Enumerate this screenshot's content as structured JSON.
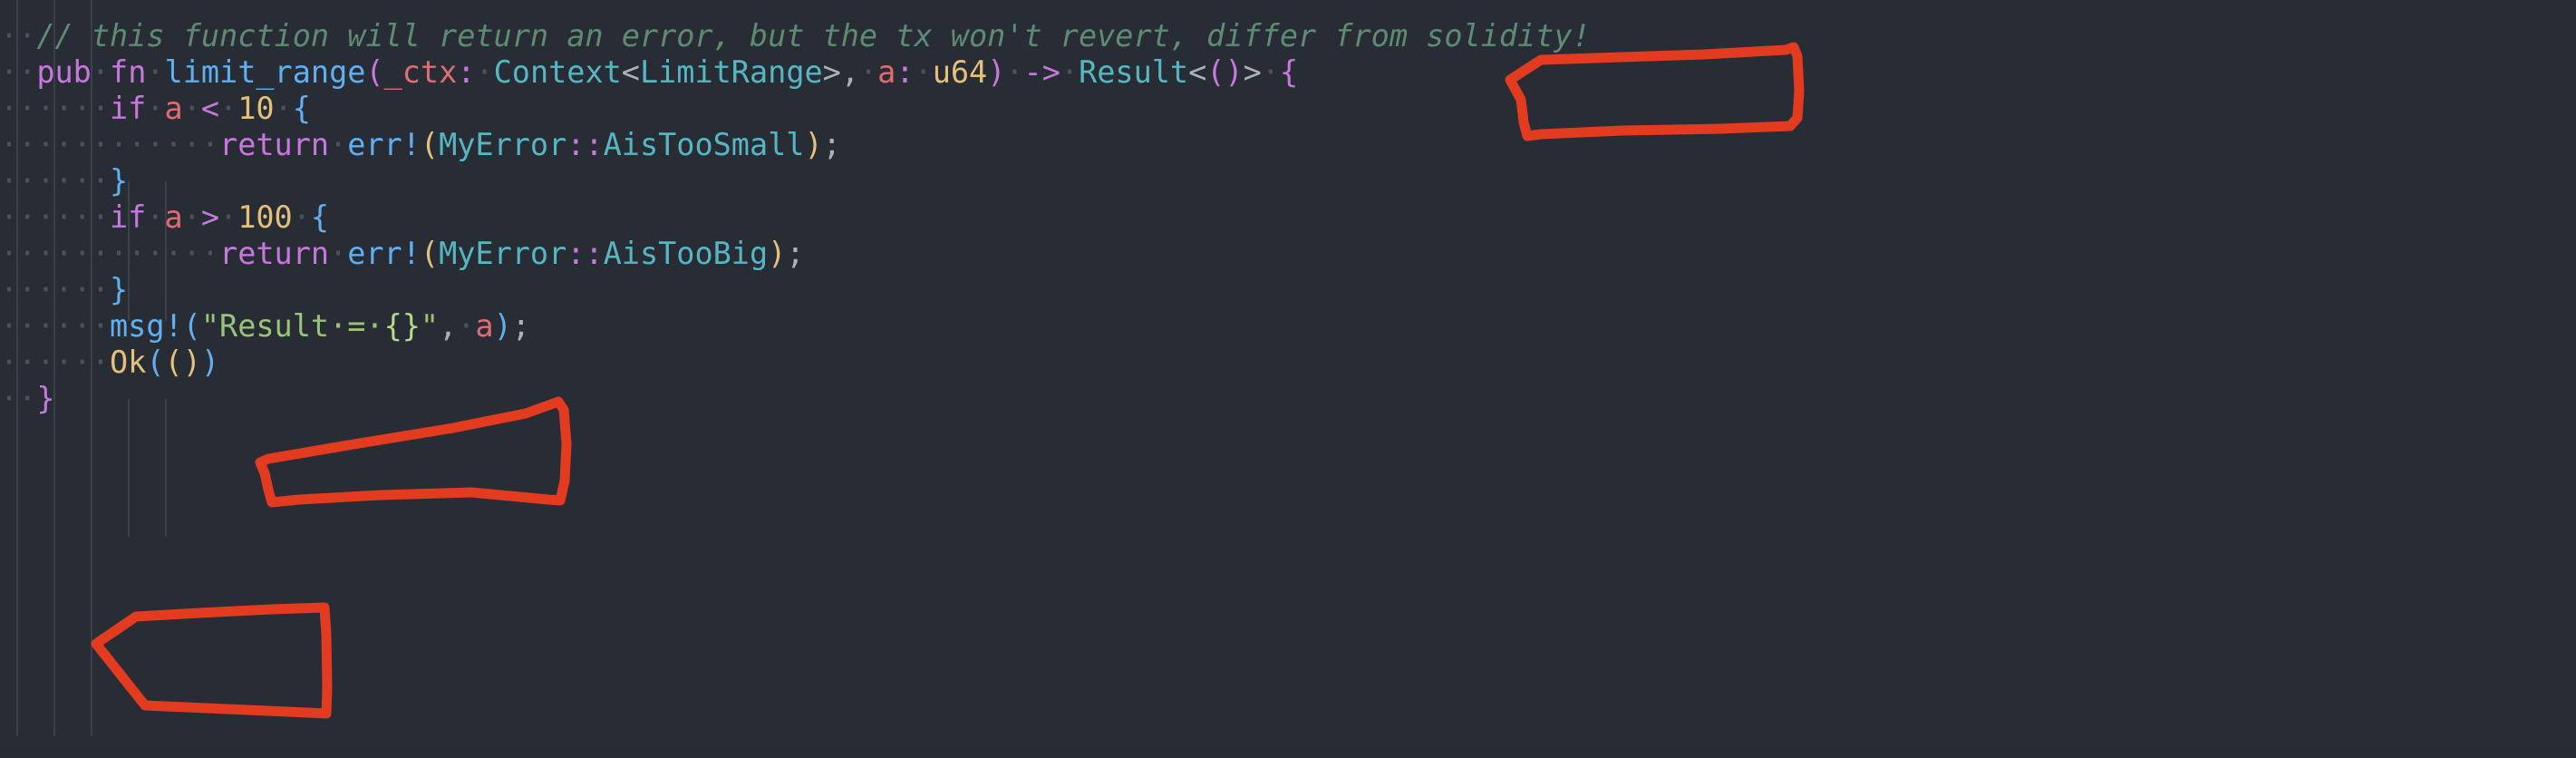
{
  "editor": {
    "background": "#282c34",
    "language": "rust",
    "whitespace_dot": "·",
    "indent_guide_color": "#3b4049",
    "font_size_px": 33.5,
    "line_height_px": 40
  },
  "annotation": {
    "color": "#e23b20",
    "stroke_width": 9,
    "tool": "freehand-marker",
    "shapes": [
      {
        "name": "highlight-box-result-type",
        "target_text": "Result<()>"
      },
      {
        "name": "highlight-box-return-err",
        "target_text": "return err!("
      },
      {
        "name": "highlight-box-ok-unit",
        "target_text": "Ok(())"
      }
    ]
  },
  "code": {
    "lines": [
      {
        "n": 1,
        "indent": 0,
        "tokens": [
          {
            "t": "··",
            "c": "ws"
          },
          {
            "t": "// this function will return an error, but the tx won't revert, differ from solidity!",
            "c": "comment"
          }
        ]
      },
      {
        "n": 2,
        "indent": 0,
        "tokens": [
          {
            "t": "··",
            "c": "ws"
          },
          {
            "t": "pub",
            "c": "keyword"
          },
          {
            "t": "·",
            "c": "ws"
          },
          {
            "t": "fn",
            "c": "keyword"
          },
          {
            "t": "·",
            "c": "ws"
          },
          {
            "t": "limit_range",
            "c": "fn"
          },
          {
            "t": "(",
            "c": "brace-m"
          },
          {
            "t": "_ctx",
            "c": "param"
          },
          {
            "t": ":",
            "c": "op"
          },
          {
            "t": "·",
            "c": "ws"
          },
          {
            "t": "Context",
            "c": "type"
          },
          {
            "t": "<",
            "c": "punct"
          },
          {
            "t": "LimitRange",
            "c": "type"
          },
          {
            "t": ">",
            "c": "punct"
          },
          {
            "t": ",",
            "c": "punct"
          },
          {
            "t": "·",
            "c": "ws"
          },
          {
            "t": "a",
            "c": "param"
          },
          {
            "t": ":",
            "c": "op"
          },
          {
            "t": "·",
            "c": "ws"
          },
          {
            "t": "u64",
            "c": "number"
          },
          {
            "t": ")",
            "c": "brace-m"
          },
          {
            "t": "·",
            "c": "ws"
          },
          {
            "t": "->",
            "c": "op"
          },
          {
            "t": "·",
            "c": "ws"
          },
          {
            "t": "Result",
            "c": "type"
          },
          {
            "t": "<",
            "c": "punct"
          },
          {
            "t": "()",
            "c": "brace-m"
          },
          {
            "t": ">",
            "c": "punct"
          },
          {
            "t": "·",
            "c": "ws"
          },
          {
            "t": "{",
            "c": "brace-m"
          }
        ]
      },
      {
        "n": 3,
        "indent": 1,
        "tokens": [
          {
            "t": "······",
            "c": "ws"
          },
          {
            "t": "if",
            "c": "keyword"
          },
          {
            "t": "·",
            "c": "ws"
          },
          {
            "t": "a",
            "c": "param"
          },
          {
            "t": "·",
            "c": "ws"
          },
          {
            "t": "<",
            "c": "op"
          },
          {
            "t": "·",
            "c": "ws"
          },
          {
            "t": "10",
            "c": "number"
          },
          {
            "t": "·",
            "c": "ws"
          },
          {
            "t": "{",
            "c": "brace-b"
          }
        ]
      },
      {
        "n": 4,
        "indent": 2,
        "tokens": [
          {
            "t": "············",
            "c": "ws"
          },
          {
            "t": "return",
            "c": "keyword"
          },
          {
            "t": "·",
            "c": "ws"
          },
          {
            "t": "err!",
            "c": "macro"
          },
          {
            "t": "(",
            "c": "brace-y"
          },
          {
            "t": "MyError",
            "c": "type"
          },
          {
            "t": "::",
            "c": "op"
          },
          {
            "t": "AisTooSmall",
            "c": "type"
          },
          {
            "t": ")",
            "c": "brace-y"
          },
          {
            "t": ";",
            "c": "punct"
          }
        ]
      },
      {
        "n": 5,
        "indent": 1,
        "tokens": [
          {
            "t": "······",
            "c": "ws"
          },
          {
            "t": "}",
            "c": "brace-b"
          }
        ]
      },
      {
        "n": 6,
        "indent": 1,
        "tokens": [
          {
            "t": "······",
            "c": "ws"
          },
          {
            "t": "if",
            "c": "keyword"
          },
          {
            "t": "·",
            "c": "ws"
          },
          {
            "t": "a",
            "c": "param"
          },
          {
            "t": "·",
            "c": "ws"
          },
          {
            "t": ">",
            "c": "op"
          },
          {
            "t": "·",
            "c": "ws"
          },
          {
            "t": "100",
            "c": "number"
          },
          {
            "t": "·",
            "c": "ws"
          },
          {
            "t": "{",
            "c": "brace-b"
          }
        ]
      },
      {
        "n": 7,
        "indent": 2,
        "tokens": [
          {
            "t": "············",
            "c": "ws"
          },
          {
            "t": "return",
            "c": "keyword"
          },
          {
            "t": "·",
            "c": "ws"
          },
          {
            "t": "err!",
            "c": "macro"
          },
          {
            "t": "(",
            "c": "brace-y"
          },
          {
            "t": "MyError",
            "c": "type"
          },
          {
            "t": "::",
            "c": "op"
          },
          {
            "t": "AisTooBig",
            "c": "type"
          },
          {
            "t": ")",
            "c": "brace-y"
          },
          {
            "t": ";",
            "c": "punct"
          }
        ]
      },
      {
        "n": 8,
        "indent": 1,
        "tokens": [
          {
            "t": "······",
            "c": "ws"
          },
          {
            "t": "}",
            "c": "brace-b"
          }
        ]
      },
      {
        "n": 9,
        "indent": 1,
        "tokens": [
          {
            "t": "······",
            "c": "ws"
          },
          {
            "t": "msg!",
            "c": "macro"
          },
          {
            "t": "(",
            "c": "brace-b"
          },
          {
            "t": "\"Result·=·",
            "c": "string"
          },
          {
            "t": "{}",
            "c": "fmt"
          },
          {
            "t": "\"",
            "c": "string"
          },
          {
            "t": ",",
            "c": "punct"
          },
          {
            "t": "·",
            "c": "ws"
          },
          {
            "t": "a",
            "c": "param"
          },
          {
            "t": ")",
            "c": "brace-b"
          },
          {
            "t": ";",
            "c": "punct"
          }
        ]
      },
      {
        "n": 10,
        "indent": 1,
        "tokens": [
          {
            "t": "······",
            "c": "ws"
          },
          {
            "t": "Ok",
            "c": "ok"
          },
          {
            "t": "(",
            "c": "brace-b"
          },
          {
            "t": "()",
            "c": "brace-y"
          },
          {
            "t": ")",
            "c": "brace-b"
          }
        ]
      },
      {
        "n": 11,
        "indent": 0,
        "tokens": [
          {
            "t": "··",
            "c": "ws"
          },
          {
            "t": "}",
            "c": "brace-m"
          }
        ]
      }
    ],
    "plain_text": "// this function will return an error, but the tx won't revert, differ from solidity!\npub fn limit_range(_ctx: Context<LimitRange>, a: u64) -> Result<()> {\n    if a < 10 {\n        return err!(MyError::AisTooSmall);\n    }\n    if a > 100 {\n        return err!(MyError::AisTooBig);\n    }\n    msg!(\"Result = {}\", a);\n    Ok(())\n}"
  }
}
